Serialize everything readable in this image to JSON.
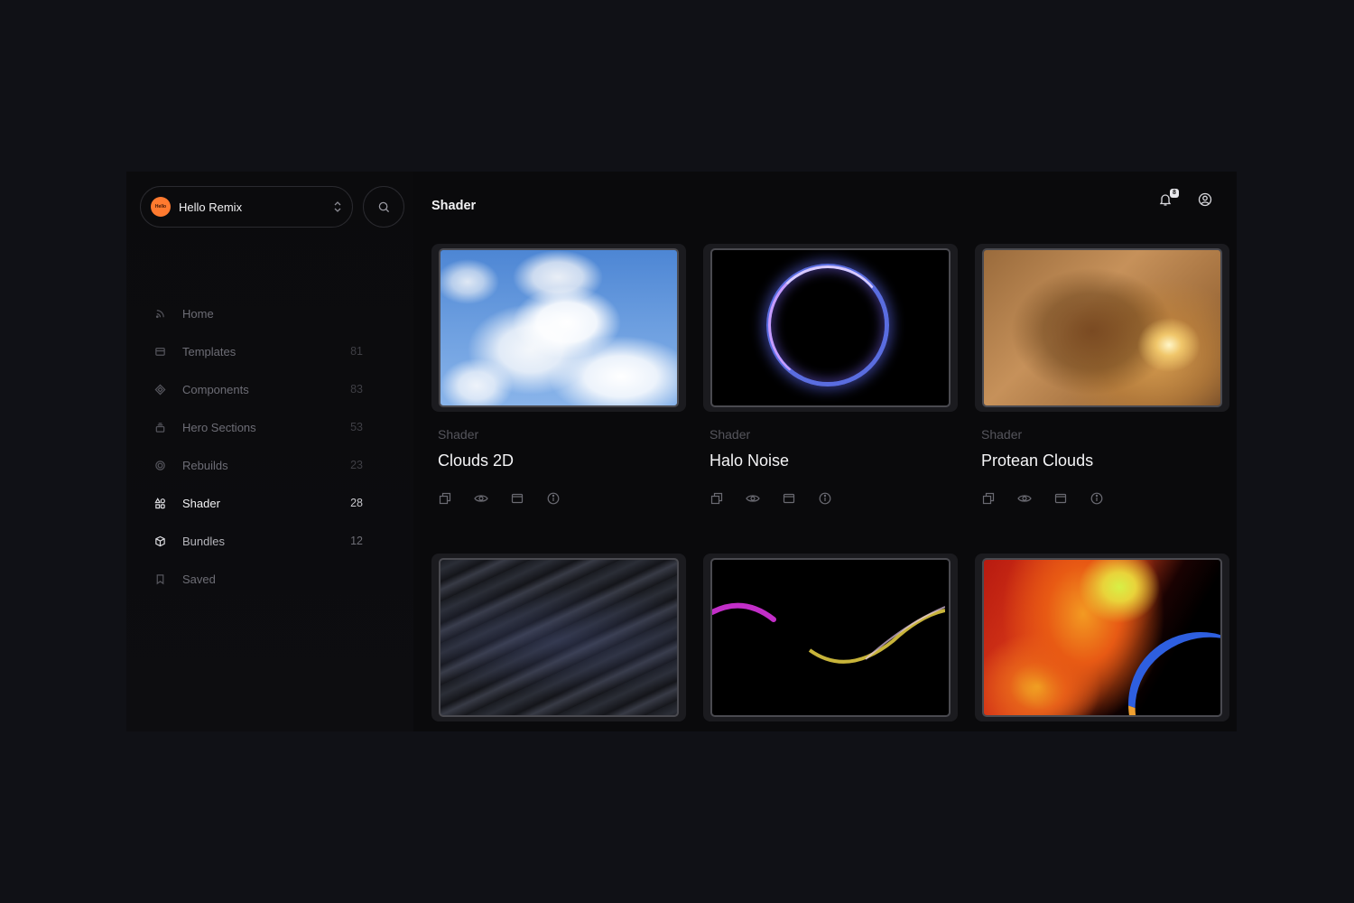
{
  "workspace": {
    "logo_text": "Hello",
    "name": "Hello Remix"
  },
  "header": {
    "title": "Shader",
    "notification_count": "8"
  },
  "sidebar": {
    "items": [
      {
        "label": "Home",
        "count": "",
        "icon": "feed-icon"
      },
      {
        "label": "Templates",
        "count": "81",
        "icon": "template-icon"
      },
      {
        "label": "Components",
        "count": "83",
        "icon": "component-icon"
      },
      {
        "label": "Hero Sections",
        "count": "53",
        "icon": "stack-icon"
      },
      {
        "label": "Rebuilds",
        "count": "23",
        "icon": "circle-icon"
      },
      {
        "label": "Shader",
        "count": "28",
        "icon": "shapes-icon",
        "active": true
      },
      {
        "label": "Bundles",
        "count": "12",
        "icon": "box-icon"
      },
      {
        "label": "Saved",
        "count": "",
        "icon": "bookmark-icon"
      }
    ]
  },
  "cards": [
    {
      "category": "Shader",
      "title": "Clouds 2D"
    },
    {
      "category": "Shader",
      "title": "Halo Noise"
    },
    {
      "category": "Shader",
      "title": "Protean Clouds"
    },
    {
      "category": "",
      "title": ""
    },
    {
      "category": "",
      "title": ""
    },
    {
      "category": "",
      "title": ""
    }
  ],
  "card_actions": [
    "copy-icon",
    "eye-icon",
    "browser-icon",
    "info-icon"
  ]
}
